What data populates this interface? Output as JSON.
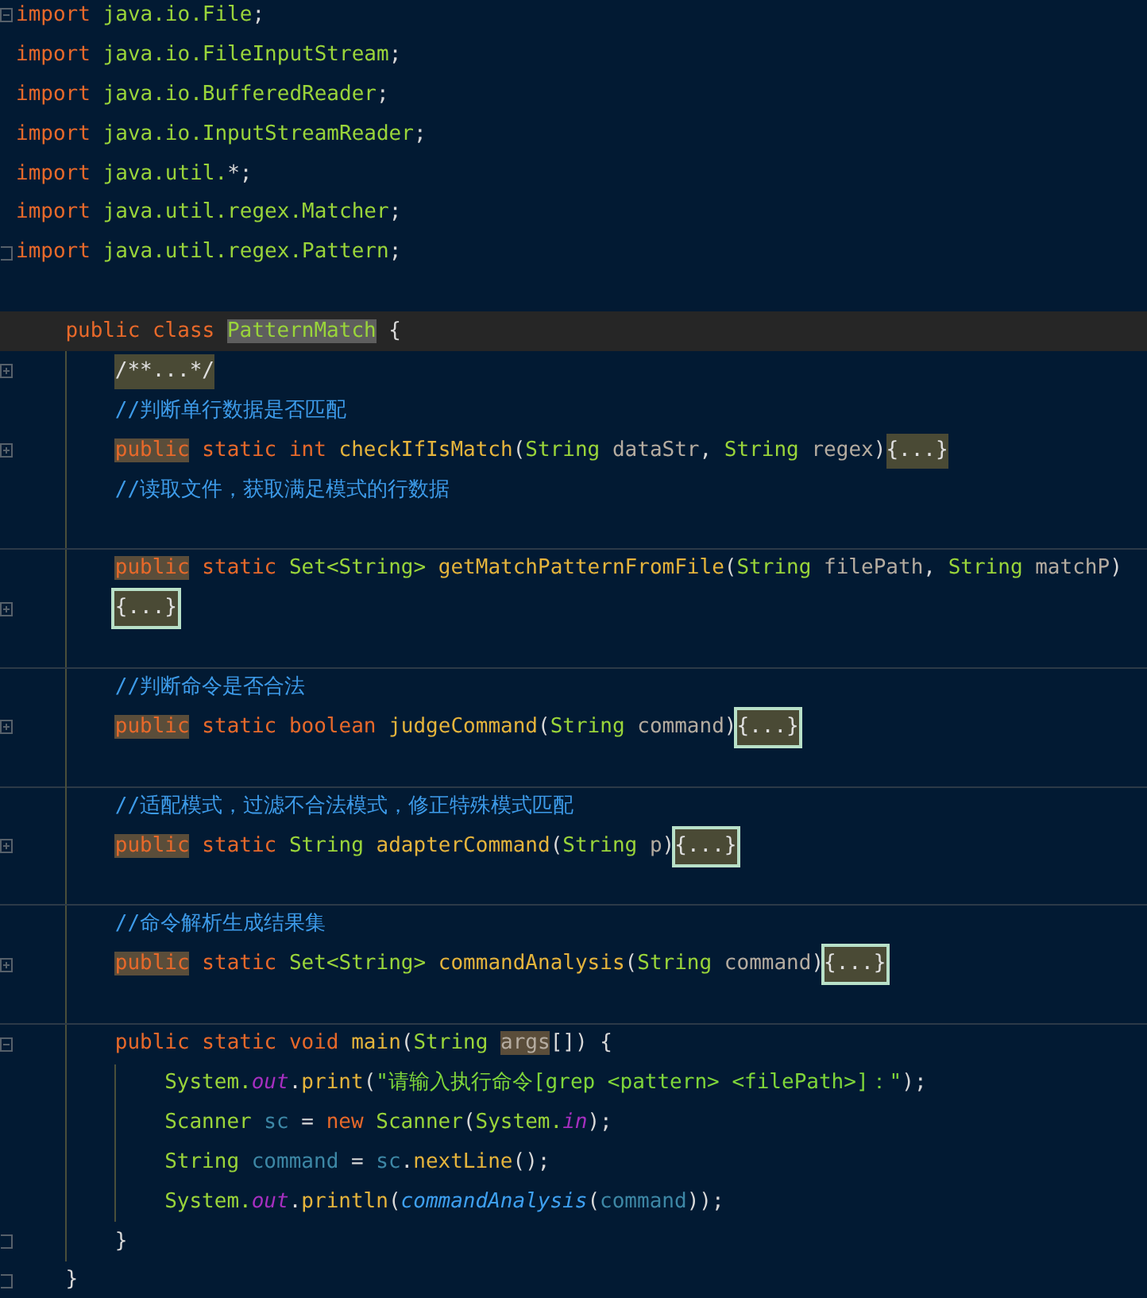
{
  "editor": {
    "lines": [
      {
        "fold": {
          "kind": "collapse"
        },
        "tokens": [
          {
            "kind": "k",
            "text": "import"
          },
          {
            "kind": "t",
            "text": " java.io.File"
          },
          {
            "kind": "x",
            "text": ";"
          }
        ]
      },
      {
        "tokens": [
          {
            "kind": "k",
            "text": "import"
          },
          {
            "kind": "t",
            "text": " java.io.FileInputStream"
          },
          {
            "kind": "x",
            "text": ";"
          }
        ]
      },
      {
        "tokens": [
          {
            "kind": "k",
            "text": "import"
          },
          {
            "kind": "t",
            "text": " java.io.BufferedReader"
          },
          {
            "kind": "x",
            "text": ";"
          }
        ]
      },
      {
        "tokens": [
          {
            "kind": "k",
            "text": "import"
          },
          {
            "kind": "t",
            "text": " java.io.InputStreamReader"
          },
          {
            "kind": "x",
            "text": ";"
          }
        ]
      },
      {
        "tokens": [
          {
            "kind": "k",
            "text": "import"
          },
          {
            "kind": "t",
            "text": " java.util."
          },
          {
            "kind": "x",
            "text": "*;"
          }
        ]
      },
      {
        "tokens": [
          {
            "kind": "k",
            "text": "import"
          },
          {
            "kind": "t",
            "text": " java.util.regex.Matcher"
          },
          {
            "kind": "x",
            "text": ";"
          }
        ]
      },
      {
        "fold": {
          "kind": "end"
        },
        "tokens": [
          {
            "kind": "k",
            "text": "import"
          },
          {
            "kind": "t",
            "text": " java.util.regex.Pattern"
          },
          {
            "kind": "x",
            "text": ";"
          }
        ]
      },
      {
        "current": false
      },
      {
        "current": true,
        "indent": {
          "kind": "class"
        },
        "tokens": [
          {
            "kind": "k",
            "text": "public class "
          },
          {
            "kind": "c",
            "text": "PatternMatch"
          },
          {
            "kind": "x",
            "text": " {"
          }
        ]
      },
      {
        "fold": {
          "kind": "expand"
        },
        "indent": {
          "kind": "member"
        },
        "tokens": [
          {
            "kind": "fd",
            "text": "/**...*/"
          }
        ]
      },
      {
        "indent": {
          "kind": "member"
        },
        "tokens": [
          {
            "kind": "cm",
            "text": "//判断单行数据是否匹配"
          }
        ]
      },
      {
        "fold": {
          "kind": "expand"
        },
        "indent": {
          "kind": "member"
        },
        "tokens": [
          {
            "kind": "km",
            "text": "public"
          },
          {
            "kind": "k",
            "text": " static int "
          },
          {
            "kind": "m",
            "text": "checkIfIsMatch"
          },
          {
            "kind": "x",
            "text": "("
          },
          {
            "kind": "t",
            "text": "String"
          },
          {
            "kind": "p",
            "text": " dataStr"
          },
          {
            "kind": "x",
            "text": ", "
          },
          {
            "kind": "t",
            "text": "String"
          },
          {
            "kind": "p",
            "text": " regex"
          },
          {
            "kind": "x",
            "text": ")"
          },
          {
            "kind": "fd",
            "text": "{...}"
          }
        ]
      },
      {
        "indent": {
          "kind": "member"
        },
        "tokens": [
          {
            "kind": "cm",
            "text": "//读取文件，获取满足模式的行数据"
          }
        ]
      },
      {
        "indent": {
          "kind": "member"
        }
      },
      {
        "divider": true,
        "indent": {
          "kind": "member"
        },
        "tokens": [
          {
            "kind": "km",
            "text": "public"
          },
          {
            "kind": "k",
            "text": " static "
          },
          {
            "kind": "t",
            "text": "Set<String>"
          },
          {
            "kind": "m",
            "text": " getMatchPatternFromFile"
          },
          {
            "kind": "x",
            "text": "("
          },
          {
            "kind": "t",
            "text": "String"
          },
          {
            "kind": "p",
            "text": " filePath"
          },
          {
            "kind": "x",
            "text": ", "
          },
          {
            "kind": "t",
            "text": "String"
          },
          {
            "kind": "p",
            "text": " matchP"
          },
          {
            "kind": "x",
            "text": ")"
          }
        ]
      },
      {
        "fold": {
          "kind": "expand"
        },
        "indent": {
          "kind": "member"
        },
        "tokens": [
          {
            "kind": "ff",
            "text": "{...}"
          }
        ]
      },
      {
        "indent": {
          "kind": "member"
        }
      },
      {
        "divider": true,
        "indent": {
          "kind": "member"
        },
        "tokens": [
          {
            "kind": "cm",
            "text": "//判断命令是否合法"
          }
        ]
      },
      {
        "fold": {
          "kind": "expand"
        },
        "indent": {
          "kind": "member"
        },
        "tokens": [
          {
            "kind": "km",
            "text": "public"
          },
          {
            "kind": "k",
            "text": " static boolean "
          },
          {
            "kind": "m",
            "text": "judgeCommand"
          },
          {
            "kind": "x",
            "text": "("
          },
          {
            "kind": "t",
            "text": "String"
          },
          {
            "kind": "p",
            "text": " command"
          },
          {
            "kind": "x",
            "text": ")"
          },
          {
            "kind": "ff",
            "text": "{...}"
          }
        ]
      },
      {
        "indent": {
          "kind": "member"
        }
      },
      {
        "divider": true,
        "indent": {
          "kind": "member"
        },
        "tokens": [
          {
            "kind": "cm",
            "text": "//适配模式，过滤不合法模式，修正特殊模式匹配"
          }
        ]
      },
      {
        "fold": {
          "kind": "expand"
        },
        "indent": {
          "kind": "member"
        },
        "tokens": [
          {
            "kind": "km",
            "text": "public"
          },
          {
            "kind": "k",
            "text": " static "
          },
          {
            "kind": "t",
            "text": "String"
          },
          {
            "kind": "m",
            "text": " adapterCommand"
          },
          {
            "kind": "x",
            "text": "("
          },
          {
            "kind": "t",
            "text": "String"
          },
          {
            "kind": "p",
            "text": " p"
          },
          {
            "kind": "x",
            "text": ")"
          },
          {
            "kind": "ff",
            "text": "{...}"
          }
        ]
      },
      {
        "indent": {
          "kind": "member"
        }
      },
      {
        "divider": true,
        "indent": {
          "kind": "member"
        },
        "tokens": [
          {
            "kind": "cm",
            "text": "//命令解析生成结果集"
          }
        ]
      },
      {
        "fold": {
          "kind": "expand"
        },
        "indent": {
          "kind": "member"
        },
        "tokens": [
          {
            "kind": "km",
            "text": "public"
          },
          {
            "kind": "k",
            "text": " static "
          },
          {
            "kind": "t",
            "text": "Set<String>"
          },
          {
            "kind": "m",
            "text": " commandAnalysis"
          },
          {
            "kind": "x",
            "text": "("
          },
          {
            "kind": "t",
            "text": "String"
          },
          {
            "kind": "p",
            "text": " command"
          },
          {
            "kind": "x",
            "text": ")"
          },
          {
            "kind": "ff",
            "text": "{...}"
          }
        ]
      },
      {
        "indent": {
          "kind": "member"
        }
      },
      {
        "divider": true,
        "fold": {
          "kind": "collapse"
        },
        "indent": {
          "kind": "member"
        },
        "tokens": [
          {
            "kind": "k",
            "text": "public static void "
          },
          {
            "kind": "m",
            "text": "main"
          },
          {
            "kind": "x",
            "text": "("
          },
          {
            "kind": "t",
            "text": "String "
          },
          {
            "kind": "vm",
            "text": "args"
          },
          {
            "kind": "x",
            "text": "[]) {"
          }
        ]
      },
      {
        "indent": {
          "kind": "body"
        },
        "tokens": [
          {
            "kind": "t",
            "text": "System."
          },
          {
            "kind": "f",
            "text": "out"
          },
          {
            "kind": "x",
            "text": "."
          },
          {
            "kind": "m",
            "text": "print"
          },
          {
            "kind": "x",
            "text": "("
          },
          {
            "kind": "str",
            "text": "\"请输入执行命令[grep <pattern> <filePath>]：\""
          },
          {
            "kind": "x",
            "text": ");"
          }
        ]
      },
      {
        "indent": {
          "kind": "body"
        },
        "tokens": [
          {
            "kind": "t",
            "text": "Scanner"
          },
          {
            "kind": "v",
            "text": " sc"
          },
          {
            "kind": "x",
            "text": " = "
          },
          {
            "kind": "k",
            "text": "new "
          },
          {
            "kind": "t",
            "text": "Scanner"
          },
          {
            "kind": "x",
            "text": "("
          },
          {
            "kind": "t",
            "text": "System."
          },
          {
            "kind": "f",
            "text": "in"
          },
          {
            "kind": "x",
            "text": ");"
          }
        ]
      },
      {
        "indent": {
          "kind": "body"
        },
        "tokens": [
          {
            "kind": "t",
            "text": "String"
          },
          {
            "kind": "v",
            "text": " command"
          },
          {
            "kind": "x",
            "text": " = "
          },
          {
            "kind": "v",
            "text": "sc"
          },
          {
            "kind": "x",
            "text": "."
          },
          {
            "kind": "m",
            "text": "nextLine"
          },
          {
            "kind": "x",
            "text": "();"
          }
        ]
      },
      {
        "indent": {
          "kind": "body"
        },
        "tokens": [
          {
            "kind": "t",
            "text": "System."
          },
          {
            "kind": "f",
            "text": "out"
          },
          {
            "kind": "x",
            "text": "."
          },
          {
            "kind": "m",
            "text": "println"
          },
          {
            "kind": "x",
            "text": "("
          },
          {
            "kind": "s",
            "text": "commandAnalysis"
          },
          {
            "kind": "x",
            "text": "("
          },
          {
            "kind": "v",
            "text": "command"
          },
          {
            "kind": "x",
            "text": "));"
          }
        ]
      },
      {
        "fold": {
          "kind": "end"
        },
        "indent": {
          "kind": "member"
        },
        "tokens": [
          {
            "kind": "x",
            "text": "}"
          }
        ]
      },
      {
        "fold": {
          "kind": "end"
        },
        "indent": {
          "kind": "class"
        },
        "tokens": [
          {
            "kind": "x",
            "text": "}"
          }
        ]
      }
    ]
  }
}
